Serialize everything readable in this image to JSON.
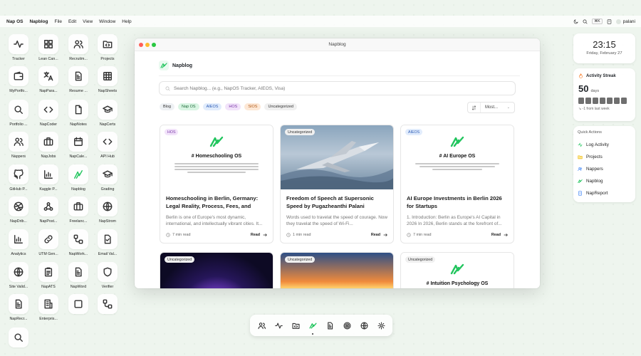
{
  "menubar": {
    "app": "Nap OS",
    "items": [
      "Napblog",
      "File",
      "Edit",
      "View",
      "Window",
      "Help"
    ],
    "shortcut": "⌘K",
    "user": "palani"
  },
  "desktop_icons": [
    {
      "label": "Tracker",
      "icon": "activity-icon"
    },
    {
      "label": "Lean Can...",
      "icon": "grid-icon"
    },
    {
      "label": "Recruitm...",
      "icon": "users-icon"
    },
    {
      "label": "Projects",
      "icon": "folder-icon"
    },
    {
      "label": "MyPortfo...",
      "icon": "wallet-icon"
    },
    {
      "label": "NapPara...",
      "icon": "translate-icon"
    },
    {
      "label": "Resume ...",
      "icon": "document-icon"
    },
    {
      "label": "NapSheets",
      "icon": "sheet-icon"
    },
    {
      "label": "Portfolio ...",
      "icon": "search-icon"
    },
    {
      "label": "NapCoder",
      "icon": "code-icon"
    },
    {
      "label": "NapNotes",
      "icon": "notes-icon"
    },
    {
      "label": "NapCerts",
      "icon": "graduation-icon"
    },
    {
      "label": "Nappers",
      "icon": "users-icon"
    },
    {
      "label": "NapJobs",
      "icon": "briefcase-icon"
    },
    {
      "label": "NapCale...",
      "icon": "calendar-icon"
    },
    {
      "label": "API Hub",
      "icon": "code-icon"
    },
    {
      "label": "GitHub P...",
      "icon": "github-icon"
    },
    {
      "label": "Kaggle P...",
      "icon": "chart-icon"
    },
    {
      "label": "Napblog",
      "icon": "napblog-icon"
    },
    {
      "label": "Grading",
      "icon": "graduation-icon"
    },
    {
      "label": "NapDrib...",
      "icon": "dribbble-icon"
    },
    {
      "label": "NapPost...",
      "icon": "webhook-icon"
    },
    {
      "label": "Freelanc...",
      "icon": "briefcase-icon"
    },
    {
      "label": "NapStrom",
      "icon": "globe-icon"
    },
    {
      "label": "Analytics",
      "icon": "chart-icon"
    },
    {
      "label": "UTM Gen...",
      "icon": "link-icon"
    },
    {
      "label": "NapWork...",
      "icon": "workflow-icon"
    },
    {
      "label": "Email Val...",
      "icon": "file-check-icon"
    },
    {
      "label": "Site Valid...",
      "icon": "globe-icon"
    },
    {
      "label": "NapATS",
      "icon": "clipboard-icon"
    },
    {
      "label": "NapWord",
      "icon": "document-icon"
    },
    {
      "label": "Verifier",
      "icon": "shield-icon"
    },
    {
      "label": "NapRecr...",
      "icon": "document-icon"
    },
    {
      "label": "Enterpris...",
      "icon": "building-icon"
    },
    {
      "label": "",
      "icon": "square-icon"
    },
    {
      "label": "",
      "icon": "workflow-icon"
    },
    {
      "label": "",
      "icon": "search-icon"
    }
  ],
  "window": {
    "title": "Napblog",
    "brand": "Napblog",
    "search_placeholder": "Search Napblog... (e.g., NapOS Tracker, AIEOS, Visa)",
    "filters": [
      {
        "label": "Blog",
        "bg": "#eef1f4",
        "fg": "#333"
      },
      {
        "label": "Nap OS",
        "bg": "#d9f5e3",
        "fg": "#1f6b3a"
      },
      {
        "label": "AIEOS",
        "bg": "#e1ecfc",
        "fg": "#2c5bb5"
      },
      {
        "label": "HOS",
        "bg": "#f2e3fa",
        "fg": "#7a38a8"
      },
      {
        "label": "SIOS",
        "bg": "#fde8d6",
        "fg": "#b15a17"
      },
      {
        "label": "Uncategorized",
        "bg": "#f0f0f0",
        "fg": "#333"
      }
    ],
    "sort": "Most...",
    "posts": [
      {
        "tag": "HOS",
        "doc_title": "# Homeschooling OS",
        "title": "Homeschooling in Berlin, Germany: Legal Reality, Process, Fees, and Strategic...",
        "excerpt": "Berlin is one of Europe's most dynamic, international, and intellectually vibrant cities. It...",
        "read_time": "7 min read",
        "read_label": "Read"
      },
      {
        "tag": "Uncategorized",
        "title": "Freedom of Speech at Supersonic Speed by Pugazheanthi Palani",
        "excerpt": "Words used to travelat the speed of courage. Now they travelat the speed of Wi-Fi...",
        "read_time": "1 min read",
        "read_label": "Read"
      },
      {
        "tag": "AIEOS",
        "doc_title": "# AI Europe OS",
        "title": "AI Europe Investments in Berlin 2026 for Startups",
        "excerpt": "1. Introduction: Berlin as Europe's AI Capital in 2026 In 2026, Berlin stands at the forefront of...",
        "read_time": "7 min read",
        "read_label": "Read"
      },
      {
        "tag": "Uncategorized"
      },
      {
        "tag": "Uncategorized"
      },
      {
        "tag": "Uncategorized",
        "doc_title": "# Intuition Psychology OS"
      }
    ]
  },
  "clock": {
    "time": "23:15",
    "date": "Friday, February 27"
  },
  "streak": {
    "title": "Activity Streak",
    "days": "50",
    "unit": "days",
    "delta": "↘ -1 from last week"
  },
  "quick_actions": {
    "title": "Quick Actions",
    "items": [
      "Log Activity",
      "Projects",
      "Nappers",
      "Napblog",
      "NapReport"
    ]
  },
  "colors": {
    "accent": "#22c55e",
    "window_bg": "#ffffff",
    "desktop_bg": "#eef5ee"
  }
}
